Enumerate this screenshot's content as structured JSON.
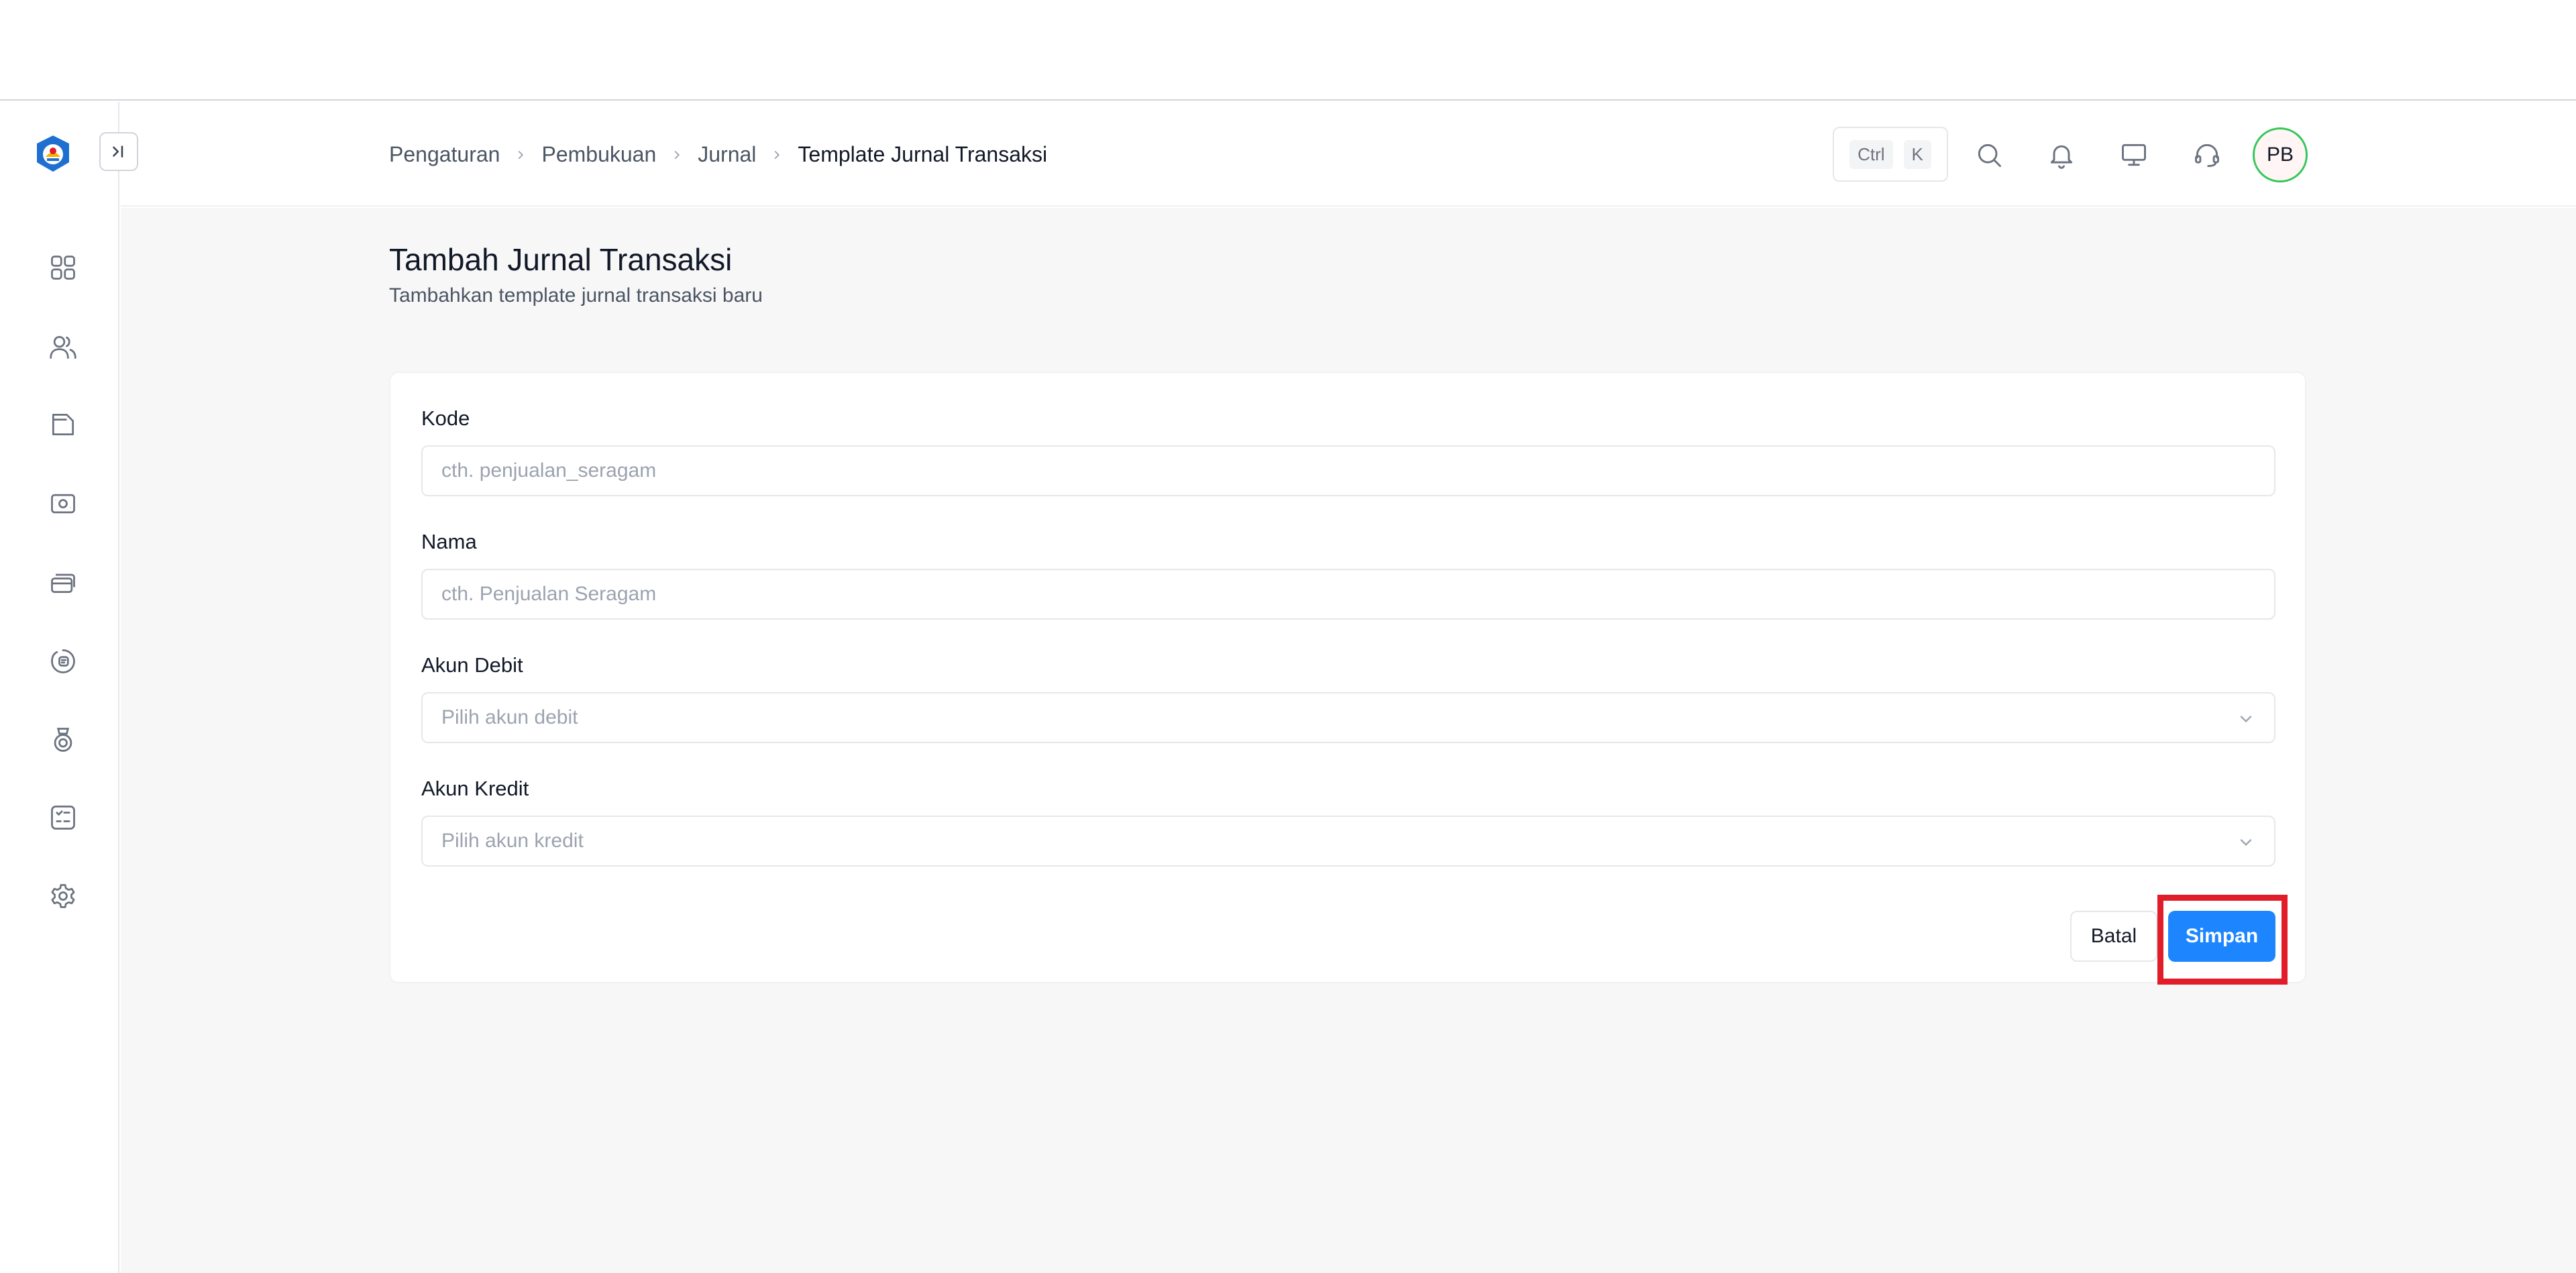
{
  "header": {
    "breadcrumb": [
      "Pengaturan",
      "Pembukuan",
      "Jurnal",
      "Template Jurnal Transaksi"
    ],
    "shortcut": {
      "key1": "Ctrl",
      "key2": "K"
    },
    "avatar_initials": "PB"
  },
  "sidebar": {
    "items": [
      {
        "icon": "dashboard-grid-icon"
      },
      {
        "icon": "users-icon"
      },
      {
        "icon": "folder-icon"
      },
      {
        "icon": "cash-icon"
      },
      {
        "icon": "cards-icon"
      },
      {
        "icon": "badge-icon"
      },
      {
        "icon": "medal-icon"
      },
      {
        "icon": "checklist-icon"
      },
      {
        "icon": "settings-icon"
      }
    ]
  },
  "page": {
    "title": "Tambah Jurnal Transaksi",
    "subtitle": "Tambahkan template jurnal transaksi baru"
  },
  "form": {
    "kode": {
      "label": "Kode",
      "placeholder": "cth. penjualan_seragam",
      "value": ""
    },
    "nama": {
      "label": "Nama",
      "placeholder": "cth. Penjualan Seragam",
      "value": ""
    },
    "akun_debit": {
      "label": "Akun Debit",
      "placeholder": "Pilih akun debit"
    },
    "akun_kredit": {
      "label": "Akun Kredit",
      "placeholder": "Pilih akun kredit"
    },
    "cancel_label": "Batal",
    "submit_label": "Simpan"
  },
  "colors": {
    "primary": "#1d86ff",
    "highlight": "#e11d2a",
    "avatar_ring": "#34c759"
  }
}
